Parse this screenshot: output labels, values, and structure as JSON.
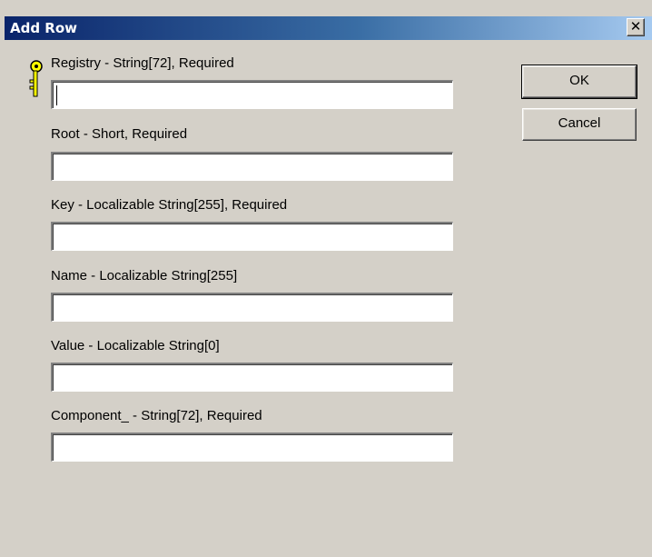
{
  "window": {
    "title": "Add Row",
    "close_glyph": "✕"
  },
  "fields": [
    {
      "label": "Registry - String[72], Required",
      "value": "",
      "is_key": true
    },
    {
      "label": "Root - Short, Required",
      "value": ""
    },
    {
      "label": "Key - Localizable String[255], Required",
      "value": ""
    },
    {
      "label": "Name - Localizable String[255]",
      "value": ""
    },
    {
      "label": "Value - Localizable String[0]",
      "value": ""
    },
    {
      "label": "Component_ - String[72], Required",
      "value": ""
    }
  ],
  "buttons": {
    "ok_label": "OK",
    "cancel_label": "Cancel"
  },
  "icons": {
    "primary_key": "key-icon",
    "close": "close-icon"
  },
  "colors": {
    "face": "#d4d0c8",
    "title_start": "#0a246a",
    "title_end": "#a6caf0",
    "key_yellow": "#ffff00"
  }
}
